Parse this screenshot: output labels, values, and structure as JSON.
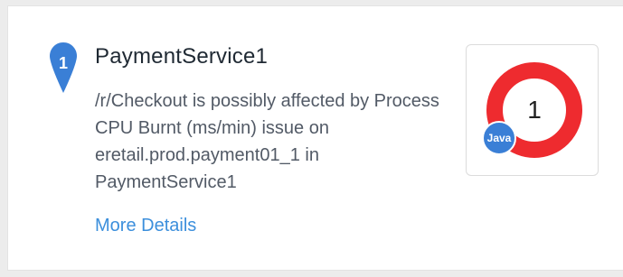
{
  "alert": {
    "rank": "1",
    "service_name": "PaymentService1",
    "description": "/r/Checkout is possibly affected by Process CPU Burnt (ms/min) issue on eretail.prod.payment01_1 in PaymentService1",
    "more_details_label": "More Details"
  },
  "badge": {
    "count": "1",
    "language": "Java"
  },
  "colors": {
    "pin": "#3a7fd6",
    "ring": "#ee2b2f",
    "link": "#3c8fdc"
  }
}
